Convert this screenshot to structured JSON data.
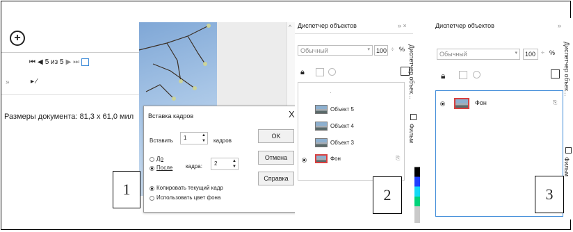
{
  "panel1": {
    "frame_counter": "5 из 5",
    "doc_size": "Размеры документа: 81,3 x 61,0 мил"
  },
  "dialog": {
    "title": "Вставка кадров",
    "close": "X",
    "insert_label": "Вставить",
    "insert_value": "1",
    "frames_unit": "кадров",
    "before_label": "До",
    "after_label": "После",
    "frame_label": "кадра:",
    "frame_value": "2",
    "copy_frame": "Копировать текущий кадр",
    "use_bg": "Использовать цвет фона",
    "ok": "OK",
    "cancel": "Отмена",
    "help": "Справка"
  },
  "panel2": {
    "title": "Диспетчер объектов",
    "mode": "Обычный",
    "opacity": "100",
    "percent": "%",
    "objects": [
      "Объект 5",
      "Объект 4",
      "Объект 3",
      "Фон"
    ],
    "side_tab": "Диспетчер объек...",
    "side_tab2": "Фильм"
  },
  "panel3": {
    "title": "Диспетчер объектов",
    "mode": "Обычный",
    "opacity": "100",
    "percent": "%",
    "objects": [
      "Фон"
    ],
    "side_tab": "Диспетчер объек...",
    "side_tab2": "Фильм"
  },
  "labels": [
    "1",
    "2",
    "3"
  ],
  "colors": {
    "accent": "#3c8ad8",
    "red_border": "#d84040"
  }
}
